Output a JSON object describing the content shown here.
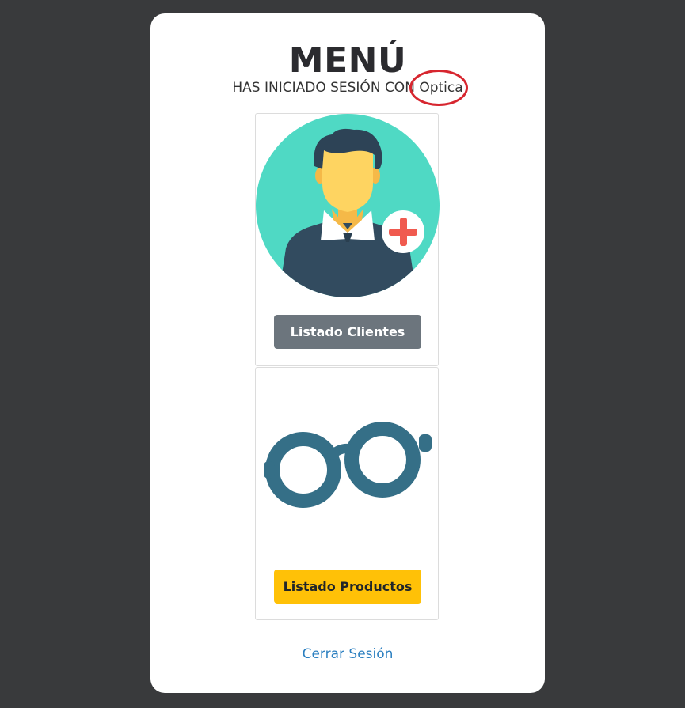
{
  "header": {
    "title": "MENÚ",
    "session_prefix": "HAS INICIADO SESIÓN CON",
    "session_user": "Optica"
  },
  "menu": {
    "clients_button": "Listado Clientes",
    "products_button": "Listado Productos"
  },
  "footer": {
    "logout_link": "Cerrar Sesión"
  },
  "colors": {
    "background": "#393a3c",
    "card": "#ffffff",
    "button_gray": "#6c757d",
    "button_yellow": "#ffc107",
    "link": "#2b7fc0",
    "highlight_ring": "#d7262f",
    "avatar_circle": "#4fd9c4",
    "glasses": "#356f87"
  },
  "icons": {
    "clients": "add-user-icon",
    "products": "glasses-icon"
  }
}
